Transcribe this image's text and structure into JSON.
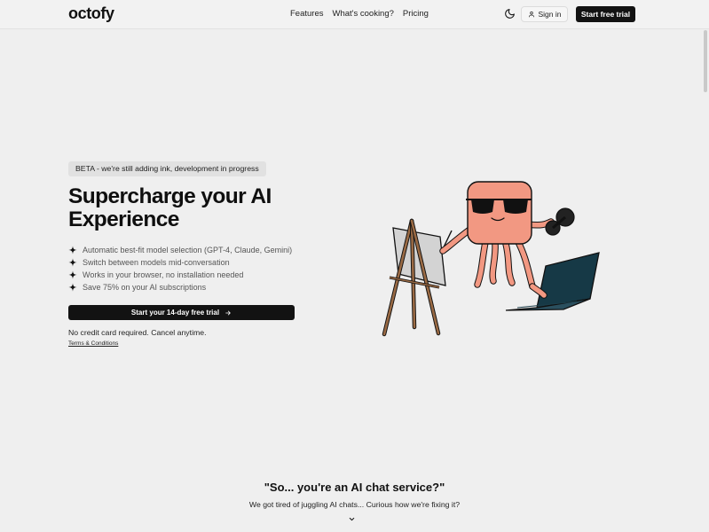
{
  "nav": {
    "logo": "octofy",
    "links": [
      "Features",
      "What's cooking?",
      "Pricing"
    ],
    "theme_icon": "moon-icon",
    "signin_label": "Sign in",
    "signin_icon": "user-icon",
    "trial_label": "Start free trial"
  },
  "hero": {
    "badge": "BETA - we're still adding ink, development in progress",
    "title": "Supercharge your AI Experience",
    "features": [
      "Automatic best-fit model selection (GPT-4, Claude, Gemini)",
      "Switch between models mid-conversation",
      "Works in your browser, no installation needed",
      "Save 75% on your AI subscriptions"
    ],
    "feature_icon": "sparkle-icon",
    "cta_label": "Start your 14-day free trial",
    "cta_icon": "arrow-right-icon",
    "note": "No credit card required. Cancel anytime.",
    "terms": "Terms & Conditions"
  },
  "section": {
    "title": "\"So... you're an AI chat service?\"",
    "text": "We got tired of juggling AI chats... Curious how we're fixing it?",
    "scroll_icon": "chevron-down-icon"
  },
  "colors": {
    "background": "#efefef",
    "primary": "#121212",
    "octopus": "#f29882",
    "laptop": "#163946"
  }
}
